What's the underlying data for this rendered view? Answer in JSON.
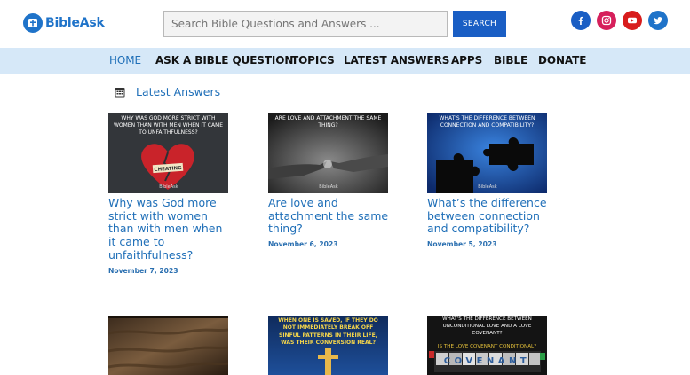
{
  "brand": {
    "name": "BibleAsk",
    "accent": "#1f73c9"
  },
  "search": {
    "placeholder": "Search Bible Questions and Answers ...",
    "button_label": "SEARCH"
  },
  "social": [
    {
      "name": "facebook-icon",
      "color": "#1a5ec4"
    },
    {
      "name": "instagram-icon",
      "color": "#d6205b"
    },
    {
      "name": "youtube-icon",
      "color": "#d81c1c"
    },
    {
      "name": "twitter-icon",
      "color": "#1f73c9"
    }
  ],
  "nav": {
    "items": [
      {
        "label": "HOME"
      },
      {
        "label": "ASK A BIBLE QUESTION"
      },
      {
        "label": "TOPICS"
      },
      {
        "label": "LATEST ANSWERS"
      },
      {
        "label": "APPS"
      },
      {
        "label": "BIBLE"
      },
      {
        "label": "DONATE"
      }
    ]
  },
  "section": {
    "title": "Latest Answers"
  },
  "articles": [
    {
      "image_caption": "WHY WAS GOD MORE STRICT WITH WOMEN THAN WITH MEN WHEN IT CAME TO UNFAITHFULNESS?",
      "image_badge": "CHEATING",
      "title": "Why was God more strict with women than with men when it came to unfaithfulness?",
      "date": "November 7, 2023"
    },
    {
      "image_caption": "ARE LOVE AND ATTACHMENT THE SAME THING?",
      "title": "Are love and attachment the same thing?",
      "date": "November 6, 2023"
    },
    {
      "image_caption": "WHAT'S THE DIFFERENCE BETWEEN CONNECTION AND COMPATIBILITY?",
      "title": "What’s the difference between connection and compatibility?",
      "date": "November 5, 2023"
    }
  ],
  "articles_row2": [
    {
      "image_caption": ""
    },
    {
      "image_caption": "WHEN ONE IS SAVED, IF THEY DO NOT IMMEDIATELY BREAK OFF SINFUL PATTERNS IN THEIR LIFE, WAS THEIR CONVERSION REAL?"
    },
    {
      "image_caption": "WHAT'S THE DIFFERENCE BETWEEN UNCONDITIONAL LOVE AND A LOVE COVENANT?",
      "image_subcaption": "IS THE LOVE COVENANT CONDITIONAL?",
      "image_word": "COVENANT"
    }
  ],
  "watermark": "BibleAsk"
}
